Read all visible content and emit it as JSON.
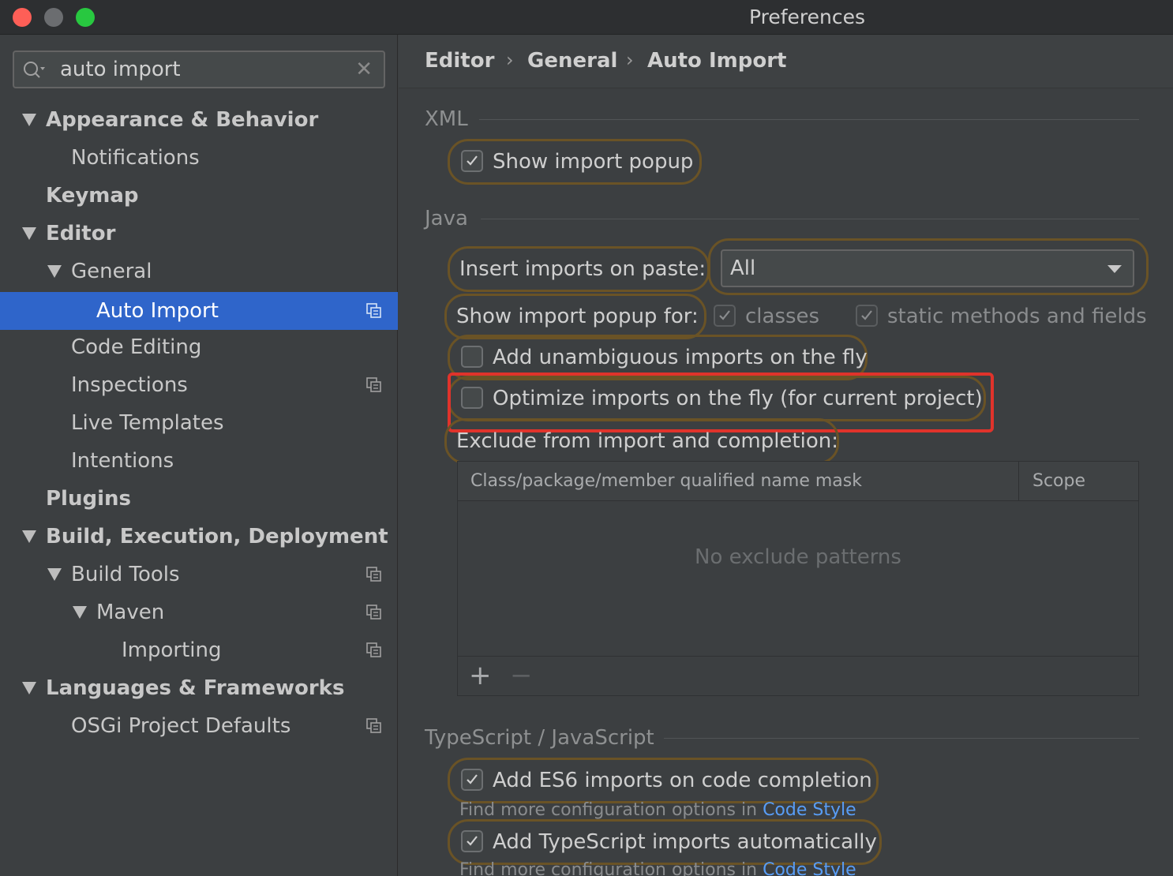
{
  "window": {
    "title": "Preferences"
  },
  "search": {
    "value": "auto import"
  },
  "sidebar": {
    "items": [
      {
        "label": "Appearance & Behavior"
      },
      {
        "label": "Notifications"
      },
      {
        "label": "Keymap"
      },
      {
        "label": "Editor"
      },
      {
        "label": "General"
      },
      {
        "label": "Auto Import"
      },
      {
        "label": "Code Editing"
      },
      {
        "label": "Inspections"
      },
      {
        "label": "Live Templates"
      },
      {
        "label": "Intentions"
      },
      {
        "label": "Plugins"
      },
      {
        "label": "Build, Execution, Deployment"
      },
      {
        "label": "Build Tools"
      },
      {
        "label": "Maven"
      },
      {
        "label": "Importing"
      },
      {
        "label": "Languages & Frameworks"
      },
      {
        "label": "OSGi Project Defaults"
      }
    ]
  },
  "breadcrumb": {
    "items": [
      "Editor",
      "General",
      "Auto Import"
    ],
    "separator": "›"
  },
  "xml": {
    "title": "XML",
    "show_import_popup": {
      "label": "Show import popup",
      "checked": true
    }
  },
  "java": {
    "title": "Java",
    "insert_imports_label": "Insert imports on paste:",
    "insert_imports_value": "All",
    "show_popup_for_label": "Show import popup for:",
    "classes_label": "classes",
    "static_label": "static methods and fields",
    "add_unambiguous": {
      "label": "Add unambiguous imports on the fly",
      "checked": false
    },
    "optimize_imports": {
      "label": "Optimize imports on the fly (for current project)",
      "checked": false
    },
    "exclude_label": "Exclude from import and completion:",
    "table": {
      "columns": [
        "Class/package/member qualified name mask",
        "Scope"
      ],
      "empty_text": "No exclude patterns",
      "add": "+",
      "remove": "−"
    }
  },
  "ts": {
    "title": "TypeScript / JavaScript",
    "es6": {
      "label": "Add ES6 imports on code completion",
      "checked": true
    },
    "hint_prefix": "Find more configuration options in",
    "hint_link": "Code Style",
    "ts_auto": {
      "label": "Add TypeScript imports automatically",
      "checked": true
    }
  },
  "colors": {
    "selection": "#2f65ca",
    "highlight_red": "#e0332b",
    "highlight_orange": "#6a5326",
    "link": "#589df6"
  }
}
